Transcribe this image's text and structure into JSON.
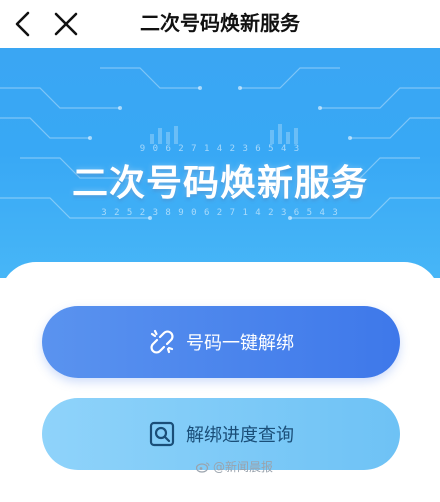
{
  "header": {
    "title": "二次号码焕新服务",
    "back_icon": "chevron-left-icon",
    "close_icon": "close-icon"
  },
  "banner": {
    "title": "二次号码焕新服务",
    "digits_top": "9 0 6 2 7 1 4 2 3 6 5 4 3",
    "digits_bottom": "3 2 5 2 3 8 9 0 6 2 7 1 4 2 3 6 5 4 3",
    "colors": {
      "background": "#38a8f5",
      "text": "#ffffff"
    }
  },
  "actions": {
    "unbind": {
      "label": "号码一键解绑",
      "icon": "unlink-icon",
      "color": "#3e78ea"
    },
    "query": {
      "label": "解绑进度查询",
      "icon": "search-icon",
      "color": "#6ec2f5"
    }
  },
  "watermark": {
    "text": "@新闻晨报",
    "icon": "weibo-icon"
  }
}
